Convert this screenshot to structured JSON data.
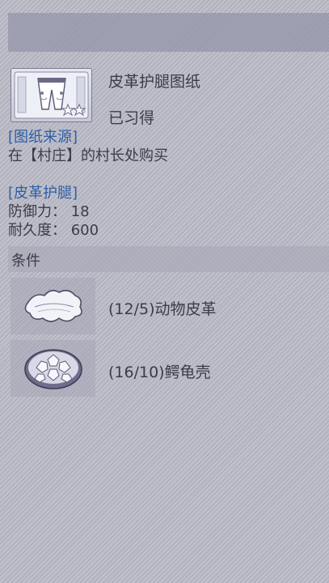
{
  "blueprint": {
    "name": "皮革护腿图纸",
    "status": "已习得",
    "icon": "leather-leggings-blueprint-icon",
    "star_count": 2
  },
  "source": {
    "heading": "[图纸来源]",
    "text": "在【村庄】的村长处购买"
  },
  "item": {
    "heading": "[皮革护腿]",
    "defense": "防御力： 18",
    "durability": "耐久度： 600"
  },
  "conditions": {
    "label": "条件",
    "materials": [
      {
        "label": "(12/5)动物皮革",
        "icon": "animal-hide-icon"
      },
      {
        "label": "(16/10)鳄龟壳",
        "icon": "turtle-shell-icon"
      }
    ]
  },
  "colors": {
    "heading_blue": "#2e5fa6",
    "text_dark": "#3c3c46",
    "background": "#b9b9c5",
    "top_bar": "#9a9aae"
  }
}
